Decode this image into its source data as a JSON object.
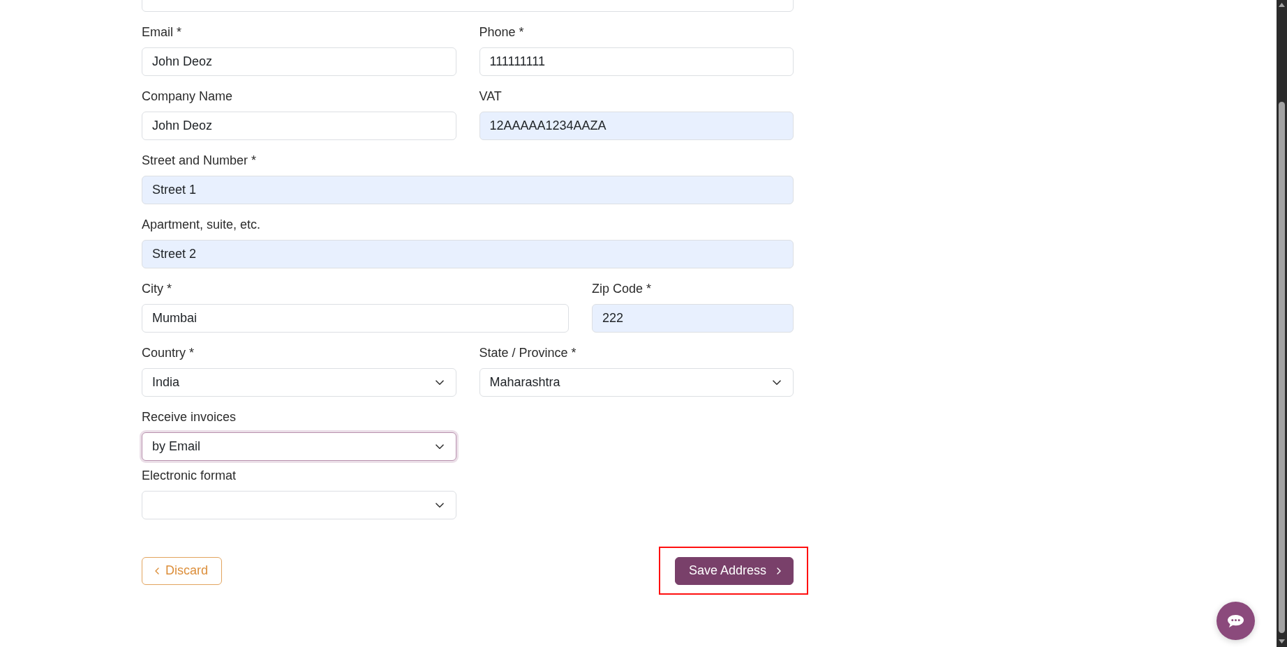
{
  "top_field": {
    "kind": "text",
    "autofilled": false
  },
  "rows": [
    [
      {
        "label": "Email *",
        "kind": "text",
        "value": "John Deoz",
        "autofilled": false
      },
      {
        "label": "Phone *",
        "kind": "text",
        "value": "111111111",
        "autofilled": false
      }
    ],
    [
      {
        "label": "Company Name",
        "kind": "text",
        "value": "John Deoz",
        "autofilled": false
      },
      {
        "label": "VAT",
        "kind": "text",
        "value": "12AAAAA1234AAZA",
        "autofilled": true
      }
    ],
    [
      {
        "label": "Street and Number *",
        "kind": "text",
        "value": "Street 1",
        "autofilled": true
      }
    ],
    [
      {
        "label": "Apartment, suite, etc.",
        "kind": "text",
        "value": "Street 2",
        "autofilled": true
      }
    ],
    [
      {
        "label": "City *",
        "kind": "text",
        "value": "Mumbai",
        "autofilled": false
      },
      {
        "label": "Zip Code *",
        "kind": "text",
        "value": "222",
        "autofilled": true
      }
    ],
    [
      {
        "label": "Country *",
        "kind": "select",
        "value": "India",
        "autofilled": false
      },
      {
        "label": "State / Province *",
        "kind": "select",
        "value": "Maharashtra",
        "autofilled": false
      }
    ]
  ],
  "invoicing": [
    {
      "label": "Receive invoices",
      "kind": "select",
      "value": "by Email",
      "focused": true
    },
    {
      "label": "Electronic format",
      "kind": "select",
      "focused": false
    }
  ],
  "buttons": [
    {
      "label": "Discard",
      "kind": "back",
      "highlighted": false
    },
    {
      "label": "Save Address",
      "kind": "forward",
      "highlighted": true
    }
  ]
}
